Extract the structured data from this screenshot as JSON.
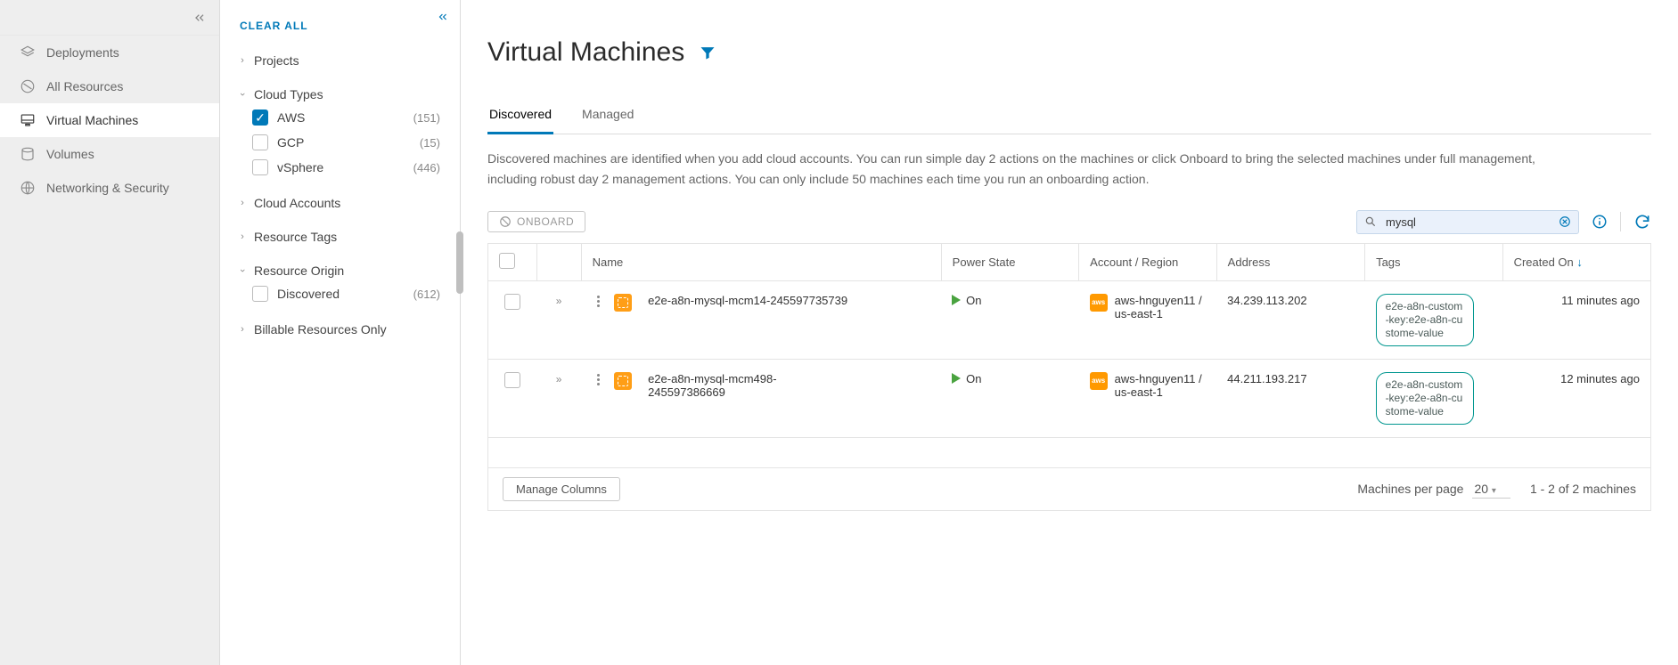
{
  "sidebar": {
    "items": [
      {
        "label": "Deployments"
      },
      {
        "label": "All Resources"
      },
      {
        "label": "Virtual Machines"
      },
      {
        "label": "Volumes"
      },
      {
        "label": "Networking & Security"
      }
    ]
  },
  "filters": {
    "clear_all": "CLEAR ALL",
    "groups": {
      "projects": "Projects",
      "cloud_types": {
        "label": "Cloud Types",
        "options": [
          {
            "label": "AWS",
            "count": "(151)",
            "checked": true
          },
          {
            "label": "GCP",
            "count": "(15)",
            "checked": false
          },
          {
            "label": "vSphere",
            "count": "(446)",
            "checked": false
          }
        ]
      },
      "cloud_accounts": "Cloud Accounts",
      "resource_tags": "Resource Tags",
      "resource_origin": {
        "label": "Resource Origin",
        "options": [
          {
            "label": "Discovered",
            "count": "(612)",
            "checked": false
          }
        ]
      },
      "billable": "Billable Resources Only"
    }
  },
  "page": {
    "title": "Virtual Machines",
    "tabs": [
      {
        "label": "Discovered"
      },
      {
        "label": "Managed"
      }
    ],
    "description": "Discovered machines are identified when you add cloud accounts. You can run simple day 2 actions on the machines or click Onboard to bring the selected machines under full management, including robust day 2 management actions. You can only include 50 machines each time you run an onboarding action.",
    "onboard_label": "ONBOARD",
    "search_value": "mysql"
  },
  "table": {
    "headers": {
      "name": "Name",
      "power": "Power State",
      "account": "Account / Region",
      "address": "Address",
      "tags": "Tags",
      "created": "Created On"
    },
    "rows": [
      {
        "name": "e2e-a8n-mysql-mcm14-245597735739",
        "power": "On",
        "account": "aws-hnguyen11 / us-east-1",
        "address": "34.239.113.202",
        "tag": "e2e-a8n-custom-key:e2e-a8n-custome-value",
        "created": "11 minutes ago"
      },
      {
        "name": "e2e-a8n-mysql-mcm498-245597386669",
        "power": "On",
        "account": "aws-hnguyen11 / us-east-1",
        "address": "44.211.193.217",
        "tag": "e2e-a8n-custom-key:e2e-a8n-custome-value",
        "created": "12 minutes ago"
      }
    ],
    "footer": {
      "manage_columns": "Manage Columns",
      "per_page_label": "Machines per page",
      "per_page_value": "20",
      "range": "1 - 2 of 2 machines"
    }
  }
}
